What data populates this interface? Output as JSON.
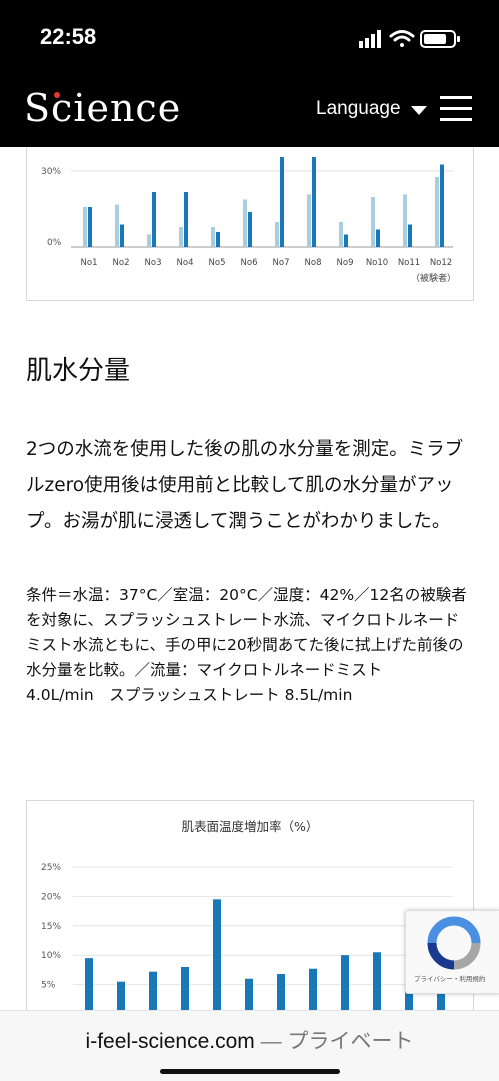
{
  "status": {
    "time": "22:58"
  },
  "header": {
    "logo": "Science",
    "language_label": "Language"
  },
  "chart1": {
    "y_ticks": [
      "30%",
      "0%"
    ],
    "x_unit_label": "（被験者）",
    "colors": {
      "before": "#a7cfe0",
      "after": "#1878b8"
    }
  },
  "section": {
    "title": "肌水分量",
    "body_lines": [
      "2つの水流を使用した後の肌の水分量を測定。ミラブ",
      "ルzero使用後は使用前と比較して肌の水分量がアッ",
      "プ。お湯が肌に浸透して潤うことがわかりました。"
    ],
    "note_lines": [
      "条件＝水温：37°C／室温：20°C／湿度：42%／12名の被験者",
      "を対象に、スプラッシュストレート水流、マイクロトルネード",
      "ミスト水流ともに、手の甲に20秒間あてた後に拭上げた前後の",
      "水分量を比較。／流量：マイクロトルネードミスト",
      "4.0L/min　スプラッシュストレート 8.5L/min"
    ]
  },
  "recaptcha": {
    "footer": "プライバシー・利用規約"
  },
  "browser": {
    "domain": "i-feel-science.com",
    "suffix": " — プライベート"
  },
  "chart_data": [
    {
      "type": "bar",
      "categories": [
        "No1",
        "No2",
        "No3",
        "No4",
        "No5",
        "No6",
        "No7",
        "No8",
        "No9",
        "No10",
        "No11",
        "No12"
      ],
      "series": [
        {
          "values": [
            16,
            17,
            5,
            8,
            8,
            19,
            10,
            21,
            10,
            20,
            21,
            28
          ]
        },
        {
          "values": [
            16,
            9,
            22,
            22,
            6,
            14,
            36,
            36,
            5,
            7,
            9,
            33
          ]
        }
      ],
      "y_ticks": [
        "30%",
        "0%"
      ],
      "xlabel": "（被験者）",
      "ylim": [
        0,
        36
      ],
      "grid": true
    },
    {
      "type": "bar",
      "title": "肌表面温度増加率（%）",
      "y_ticks": [
        "25%",
        "20%",
        "15%",
        "10%",
        "5%"
      ],
      "series": [
        {
          "values": [
            9.5,
            5.5,
            7.2,
            8.0,
            19.5,
            6.0,
            6.8,
            7.7,
            10.0,
            10.5,
            10.0,
            6.5
          ]
        }
      ],
      "ylim": [
        0,
        25
      ],
      "grid": true
    }
  ]
}
